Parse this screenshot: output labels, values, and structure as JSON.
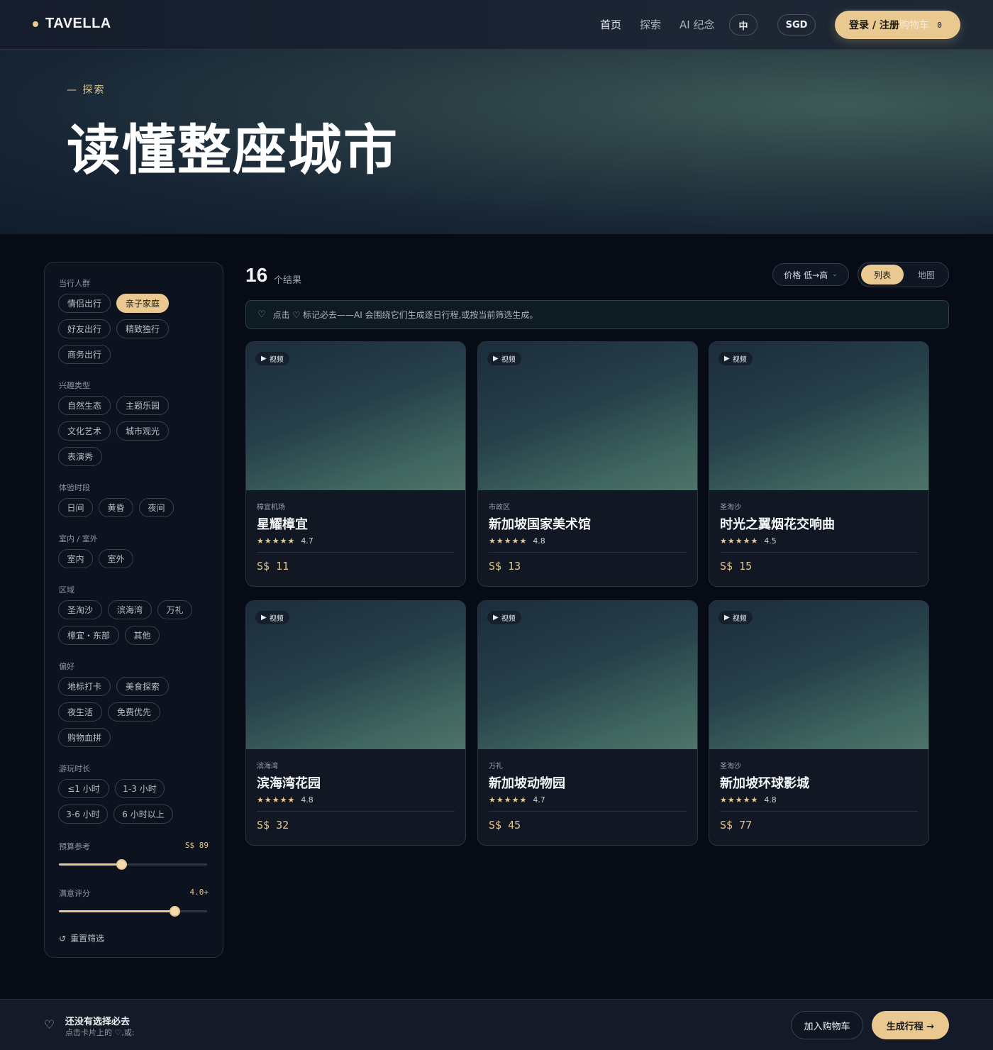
{
  "header": {
    "brand": "TAVELLA",
    "nav": [
      "首页",
      "探索",
      "AI 纪念"
    ],
    "lang": "中",
    "currency": "SGD",
    "login": "登录 / 注册",
    "cart": "购物车",
    "cart_count": "0"
  },
  "hero": {
    "eyebrow": "— 探索",
    "title": "读懂整座城市"
  },
  "filters": {
    "groups": [
      {
        "title": "当行人群",
        "chips": [
          "情侣出行",
          "亲子家庭",
          "好友出行",
          "精致独行",
          "商务出行"
        ]
      },
      {
        "title": "兴趣类型",
        "chips": [
          "自然生态",
          "主题乐园",
          "文化艺术",
          "城市观光",
          "表演秀"
        ]
      },
      {
        "title": "体验时段",
        "chips": [
          "日间",
          "黄昏",
          "夜间"
        ]
      },
      {
        "title": "室内 / 室外",
        "chips": [
          "室内",
          "室外"
        ]
      },
      {
        "title": "区域",
        "chips": [
          "圣淘沙",
          "滨海湾",
          "万礼",
          "樟宜・东部",
          "其他"
        ]
      },
      {
        "title": "偏好",
        "chips": [
          "地标打卡",
          "美食探索",
          "夜生活",
          "免费优先",
          "购物血拼"
        ]
      },
      {
        "title": "游玩时长",
        "chips": [
          "≤1 小时",
          "1-3 小时",
          "3-6 小时",
          "6 小时以上"
        ]
      }
    ],
    "budget": {
      "label": "预算参考",
      "value": "S$ 89",
      "level": 0.42
    },
    "rating": {
      "label": "满意评分",
      "value": "4.0+",
      "level": 0.78
    },
    "reset": "重置筛选"
  },
  "results": {
    "count": "16",
    "unit": "个结果",
    "sort": "价格 低→高",
    "view_list": "列表",
    "view_map": "地图",
    "hint": "点击 ♡ 标记必去——AI 会围绕它们生成逐日行程,或按当前筛选生成。"
  },
  "cards": [
    {
      "tag": "视频",
      "area": "樟宜机场",
      "name": "星耀樟宜",
      "rating": "4.7",
      "price": "S$ 11"
    },
    {
      "tag": "视频",
      "area": "市政区",
      "name": "新加坡国家美术馆",
      "rating": "4.8",
      "price": "S$ 13"
    },
    {
      "tag": "视频",
      "area": "圣淘沙",
      "name": "时光之翼烟花交响曲",
      "rating": "4.5",
      "price": "S$ 15"
    },
    {
      "tag": "视频",
      "area": "滨海湾",
      "name": "滨海湾花园",
      "rating": "4.8",
      "price": "S$ 32"
    },
    {
      "tag": "视频",
      "area": "万礼",
      "name": "新加坡动物园",
      "rating": "4.7",
      "price": "S$ 45"
    },
    {
      "tag": "视频",
      "area": "圣淘沙",
      "name": "新加坡环球影城",
      "rating": "4.8",
      "price": "S$ 77"
    }
  ],
  "bottom": {
    "title": "还没有选择必去",
    "subtitle": "点击卡片上的 ♡,或:",
    "add_cart": "加入购物车",
    "generate": "生成行程 →"
  },
  "colors": {
    "accent": "#e9c98f",
    "background": "#060b16",
    "card": "#111824"
  },
  "icons": {
    "brand_dot": "dot-icon",
    "heart": "heart-icon",
    "play": "play-icon",
    "reset": "reset-icon",
    "chevron": "chevron-down-icon",
    "star": "star-icon"
  }
}
